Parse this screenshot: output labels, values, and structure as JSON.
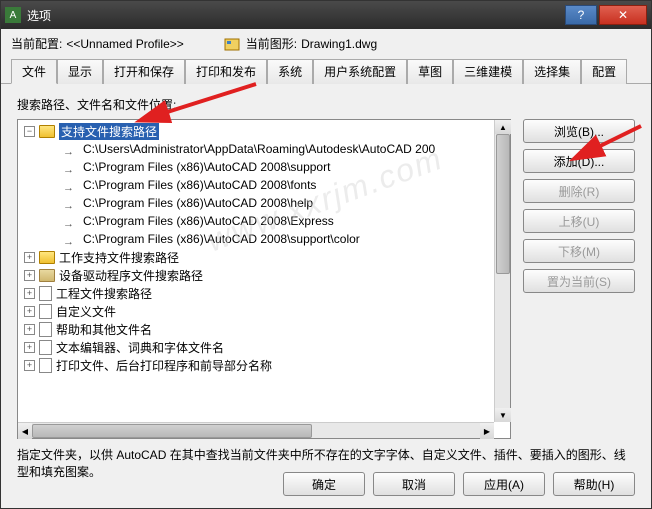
{
  "window": {
    "title": "选项"
  },
  "header": {
    "current_config_label": "当前配置:",
    "current_config_value": "<<Unnamed Profile>>",
    "current_drawing_label": "当前图形:",
    "current_drawing_value": "Drawing1.dwg"
  },
  "tabs": [
    "文件",
    "显示",
    "打开和保存",
    "打印和发布",
    "系统",
    "用户系统配置",
    "草图",
    "三维建模",
    "选择集",
    "配置"
  ],
  "active_tab": 0,
  "section_label": "搜索路径、文件名和文件位置:",
  "tree": {
    "root": {
      "label": "支持文件搜索路径",
      "expanded": true,
      "children": [
        "C:\\Users\\Administrator\\AppData\\Roaming\\Autodesk\\AutoCAD 200",
        "C:\\Program Files (x86)\\AutoCAD 2008\\support",
        "C:\\Program Files (x86)\\AutoCAD 2008\\fonts",
        "C:\\Program Files (x86)\\AutoCAD 2008\\help",
        "C:\\Program Files (x86)\\AutoCAD 2008\\Express",
        "C:\\Program Files (x86)\\AutoCAD 2008\\support\\color"
      ]
    },
    "siblings": [
      {
        "label": "工作支持文件搜索路径",
        "icon": "folder"
      },
      {
        "label": "设备驱动程序文件搜索路径",
        "icon": "folder-dim"
      },
      {
        "label": "工程文件搜索路径",
        "icon": "doc"
      },
      {
        "label": "自定义文件",
        "icon": "doc"
      },
      {
        "label": "帮助和其他文件名",
        "icon": "doc"
      },
      {
        "label": "文本编辑器、词典和字体文件名",
        "icon": "doc"
      },
      {
        "label": "打印文件、后台打印程序和前导部分名称",
        "icon": "doc"
      }
    ]
  },
  "buttons": {
    "browse": "浏览(B)...",
    "add": "添加(D)...",
    "remove": "删除(R)",
    "moveup": "上移(U)",
    "movedown": "下移(M)",
    "setcurrent": "置为当前(S)"
  },
  "description": "指定文件夹，以供 AutoCAD 在其中查找当前文件夹中所不存在的文字字体、自定义文件、插件、要插入的图形、线型和填充图案。",
  "footer": {
    "ok": "确定",
    "cancel": "取消",
    "apply": "应用(A)",
    "help": "帮助(H)"
  },
  "watermark": "www.xxrjm.com"
}
